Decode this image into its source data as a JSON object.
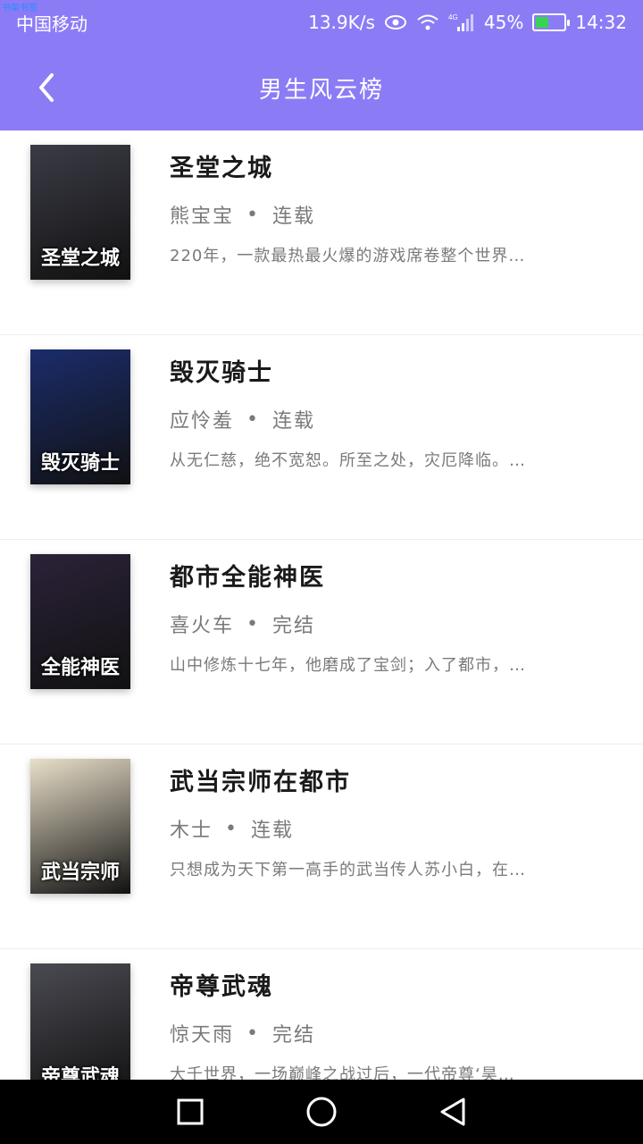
{
  "status_bar": {
    "tiny_tag": "书架书签",
    "carrier": "中国移动",
    "speed": "13.9K/s",
    "network": "4G",
    "battery": "45%",
    "battery_level": 0.45,
    "time": "14:32"
  },
  "app_bar": {
    "title": "男生风云榜"
  },
  "books": [
    {
      "title": "圣堂之城",
      "author": "熊宝宝",
      "status": "连载",
      "desc": "220年，一款最热最火爆的游戏席卷整个世界…",
      "cover_text": "圣堂之城",
      "cover_color": "#3b3b46"
    },
    {
      "title": "毁灭骑士",
      "author": "应怜羞",
      "status": "连载",
      "desc": "从无仁慈，绝不宽恕。所至之处，灾厄降临。…",
      "cover_text": "毁灭骑士",
      "cover_color": "#1b2c6b"
    },
    {
      "title": "都市全能神医",
      "author": "喜火车",
      "status": "完结",
      "desc": "山中修炼十七年，他磨成了宝剑；入了都市，…",
      "cover_text": "全能神医",
      "cover_color": "#2b2238"
    },
    {
      "title": "武当宗师在都市",
      "author": "木士",
      "status": "连载",
      "desc": "只想成为天下第一高手的武当传人苏小白，在…",
      "cover_text": "武当宗师",
      "cover_color": "#e9dfc9"
    },
    {
      "title": "帝尊武魂",
      "author": "惊天雨",
      "status": "完结",
      "desc": "大千世界，一场巅峰之战过后，一代帝尊‘昊…",
      "cover_text": "帝尊武魂",
      "cover_color": "#4a4a52"
    }
  ],
  "colors": {
    "accent": "#8b7cf6"
  }
}
